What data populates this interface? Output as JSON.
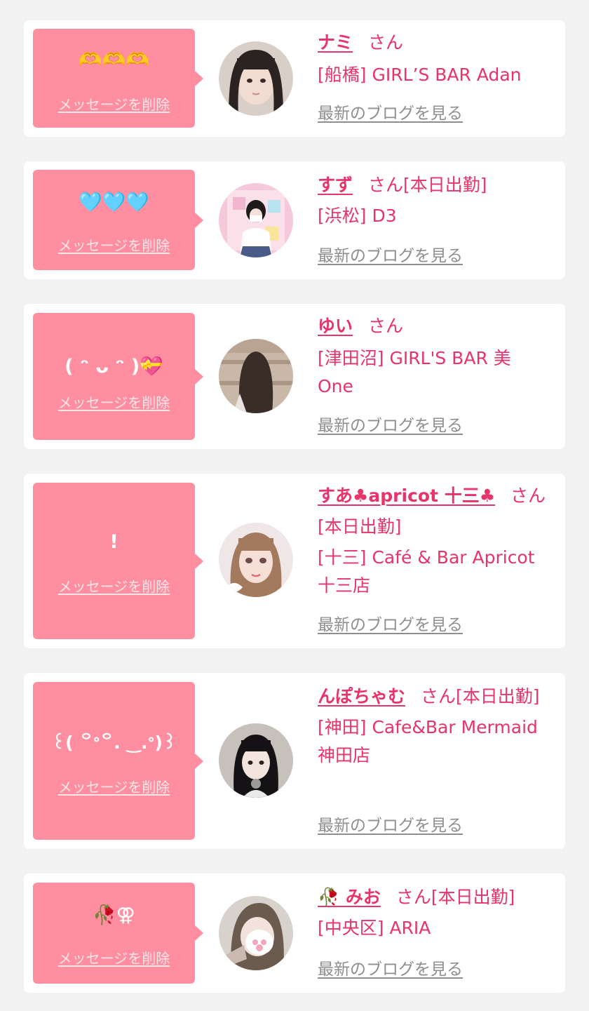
{
  "delete_label": "メッセージを削除",
  "honorific": "さん",
  "blog_label": "最新のブログを見る",
  "colors": {
    "background": "#f2f2f2",
    "card": "#ffffff",
    "message_box": "#ff8ea0",
    "accent_text": "#e8336b",
    "blog_link": "#8e8e8e"
  },
  "items": [
    {
      "message": "🫶🫶🫶",
      "name": "ナミ",
      "status": "",
      "store": "[船橋] GIRL’S BAR Adan"
    },
    {
      "message": "🩵🩵🩵",
      "name": "すず",
      "status": "[本日出勤]",
      "store": "[浜松] D3"
    },
    {
      "message": "( ᵔ ᴗ ᵔ )💝",
      "name": "ゆい",
      "status": "",
      "store": "[津田沼] GIRL'S BAR 美One"
    },
    {
      "message": "!",
      "name": "すあ♣apricot 十三♣",
      "status": "[本日出勤]",
      "store": "[十三] Café & Bar Apricot 十三店"
    },
    {
      "message": "꒰( ꒪ᐤ꒪. ‿.ᐤ)꒱",
      "name": "んぽちゃむ",
      "status": "[本日出勤]",
      "store": "[神田] Cafe&Bar Mermaid 神田店"
    },
    {
      "message": "🥀⚢",
      "name": "🥀 みお",
      "status": "[本日出勤]",
      "store": "[中央区] ARIA"
    }
  ]
}
